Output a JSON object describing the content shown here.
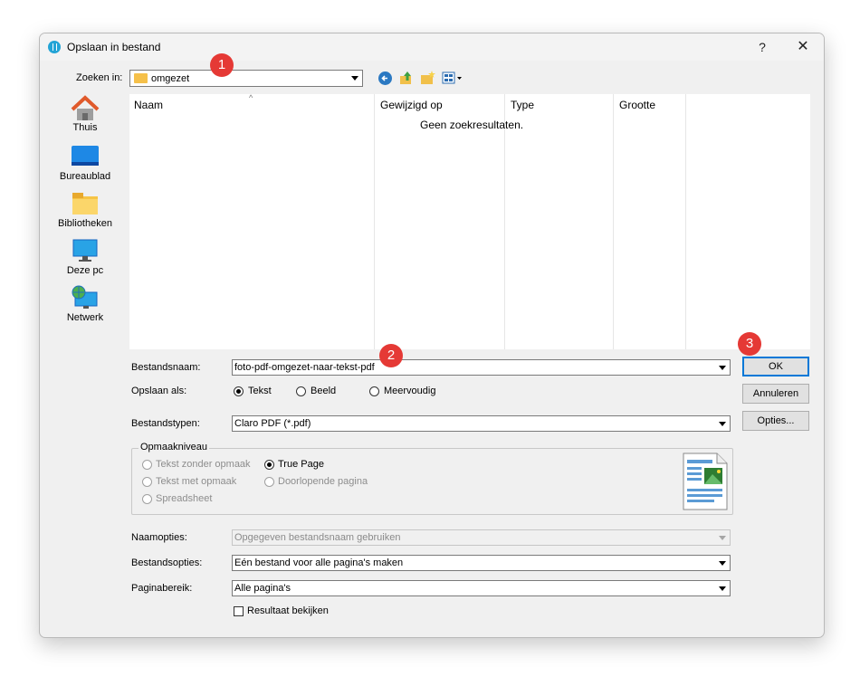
{
  "window": {
    "title": "Opslaan in bestand",
    "help": "?",
    "close": "✕"
  },
  "lookin": {
    "label": "Zoeken in:",
    "value": "omgezet"
  },
  "places": [
    {
      "label": "Thuis",
      "icon": "home-icon"
    },
    {
      "label": "Bureaublad",
      "icon": "desktop-icon"
    },
    {
      "label": "Bibliotheken",
      "icon": "libraries-icon"
    },
    {
      "label": "Deze pc",
      "icon": "this-pc-icon"
    },
    {
      "label": "Netwerk",
      "icon": "network-icon"
    }
  ],
  "filelist": {
    "columns": [
      "Naam",
      "Gewijzigd op",
      "Type",
      "Grootte"
    ],
    "empty_text": "Geen zoekresultaten."
  },
  "filename": {
    "label": "Bestandsnaam:",
    "value": "foto-pdf-omgezet-naar-tekst-pdf"
  },
  "saveas": {
    "label": "Opslaan als:",
    "options": [
      "Tekst",
      "Beeld",
      "Meervoudig"
    ],
    "selected": "Tekst"
  },
  "filetypes": {
    "label": "Bestandstypen:",
    "value": "Claro PDF (*.pdf)"
  },
  "format": {
    "title": "Opmaakniveau",
    "options": [
      "Tekst zonder opmaak",
      "Tekst met opmaak",
      "Spreadsheet",
      "True Page",
      "Doorlopende pagina"
    ],
    "selected": "True Page"
  },
  "nameoptions": {
    "label": "Naamopties:",
    "value": "Opgegeven bestandsnaam gebruiken"
  },
  "fileoptions": {
    "label": "Bestandsopties:",
    "value": "Eén bestand voor alle pagina's maken"
  },
  "pagerange": {
    "label": "Paginabereik:",
    "value": "Alle pagina's"
  },
  "view_result": {
    "label": "Resultaat bekijken",
    "checked": false
  },
  "buttons": {
    "ok": "OK",
    "cancel": "Annuleren",
    "options": "Opties..."
  },
  "badges": [
    "1",
    "2",
    "3"
  ],
  "colors": {
    "badge": "#e53935",
    "accent": "#0078d7"
  }
}
